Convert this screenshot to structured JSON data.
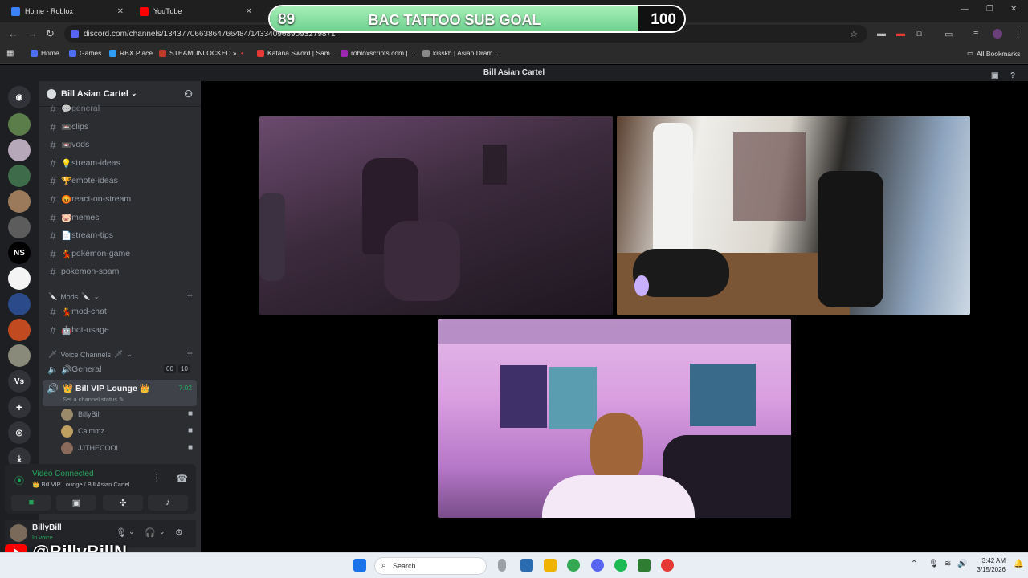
{
  "browser": {
    "tabs": [
      {
        "title": "Home - Roblox",
        "color": "#3b82f6"
      },
      {
        "title": "YouTube",
        "color": "#ff0000"
      }
    ],
    "url": "discord.com/channels/1343770663864766484/1433409689093279871",
    "bookmarks": [
      {
        "label": "Home",
        "color": "#4c6ef5"
      },
      {
        "label": "Games",
        "color": "#4c6ef5"
      },
      {
        "label": "RBX.Place",
        "color": "#2f9df4"
      },
      {
        "label": "STEAMUNLOCKED »...",
        "color": "#c0392b"
      },
      {
        "label": "Katana Sword | Sam...",
        "color": "#e53935"
      },
      {
        "label": "robloxscripts.com |...",
        "color": "#9c27b0"
      },
      {
        "label": "kisskh | Asian Dram...",
        "color": "#888888"
      }
    ],
    "all_bookmarks": "All Bookmarks"
  },
  "overlay": {
    "goal_current": "89",
    "goal_target": "100",
    "goal_title": "BAC TATTOO SUB GOAL",
    "goal_progress": 0.89,
    "yt_handle": "@BillyBillN"
  },
  "discord": {
    "window_title": "Bill Asian Cartel",
    "server_name": "Bill Asian Cartel",
    "text_channels": [
      {
        "emoji": "💬",
        "name": "general"
      },
      {
        "emoji": "📼",
        "name": "clips"
      },
      {
        "emoji": "📼",
        "name": "vods"
      },
      {
        "emoji": "💡",
        "name": "stream-ideas"
      },
      {
        "emoji": "🏆",
        "name": "emote-ideas"
      },
      {
        "emoji": "😡",
        "name": "react-on-stream"
      },
      {
        "emoji": "🐷",
        "name": "memes"
      },
      {
        "emoji": "📄",
        "name": "stream-tips"
      },
      {
        "emoji": "💃",
        "name": "pokémon-game"
      },
      {
        "emoji": "",
        "name": "pokemon-spam"
      }
    ],
    "mods_category": "Mods",
    "mod_channels": [
      {
        "emoji": "💃",
        "name": "mod-chat"
      },
      {
        "emoji": "🤖",
        "name": "bot-usage"
      }
    ],
    "voice_category": "Voice Channels",
    "voice_general": "General",
    "voice_general_count_a": "00",
    "voice_general_count_b": "10",
    "active_voice": {
      "name": "Bill VIP Lounge",
      "status": "Set a channel status",
      "time": "7:02",
      "members": [
        {
          "name": "BillyBill",
          "color": "#9a8a6a"
        },
        {
          "name": "Calmmz",
          "color": "#c0a060"
        },
        {
          "name": "JJTHECOOL",
          "color": "#8a6a5a"
        }
      ]
    },
    "voice_panel": {
      "status": "Video Connected",
      "location": "Bill VIP Lounge / Bill Asian Cartel"
    },
    "user": {
      "name": "BillyBill",
      "status": "In voice"
    }
  },
  "taskbar": {
    "search_placeholder": "Search",
    "time": "3:42 AM",
    "date": "3/15/2026"
  }
}
